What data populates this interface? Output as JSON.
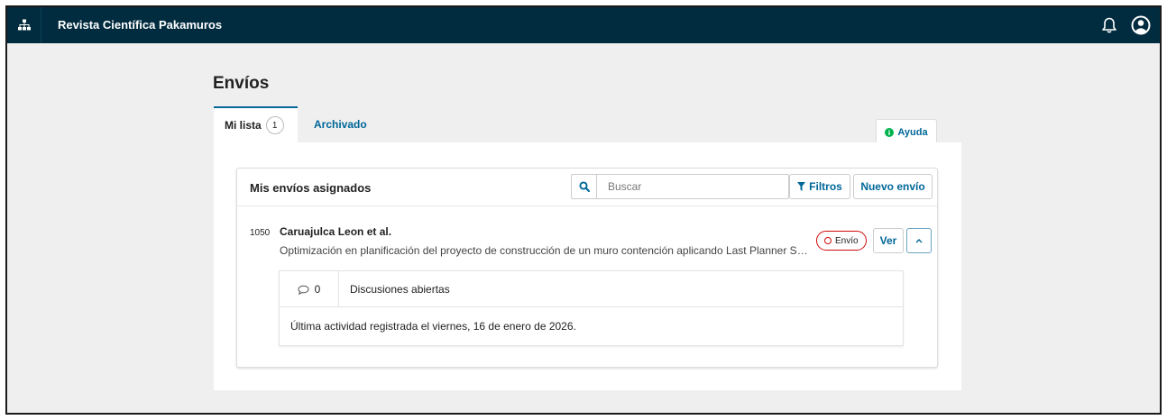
{
  "header": {
    "site_title": "Revista Científica Pakamuros",
    "icons": [
      "sitemap-icon",
      "bell-icon",
      "user-circle-icon"
    ]
  },
  "page": {
    "title": "Envíos"
  },
  "tabs": [
    {
      "label": "Mi lista",
      "count": "1",
      "active": true
    },
    {
      "label": "Archivado",
      "active": false
    }
  ],
  "help": {
    "label": "Ayuda"
  },
  "submissions": {
    "panel_title": "Mis envíos asignados",
    "search_placeholder": "Buscar",
    "filters_label": "Filtros",
    "new_label": "Nuevo envío",
    "items": [
      {
        "id": "1050",
        "authors": "Caruajulca Leon et al.",
        "title": "Optimización en planificación del proyecto de construcción de un muro contención aplicando Last Planner System",
        "stage": "Envío",
        "view_label": "Ver",
        "discussion_count": "0",
        "discussion_label": "Discusiones abiertas",
        "last_activity": "Última actividad registrada el viernes, 16 de enero de 2026."
      }
    ]
  },
  "colors": {
    "header_bg": "#012c3f",
    "accent": "#006798",
    "stage_border": "#d00a0a",
    "help_icon": "#00b24e",
    "page_bg": "#efefef"
  }
}
